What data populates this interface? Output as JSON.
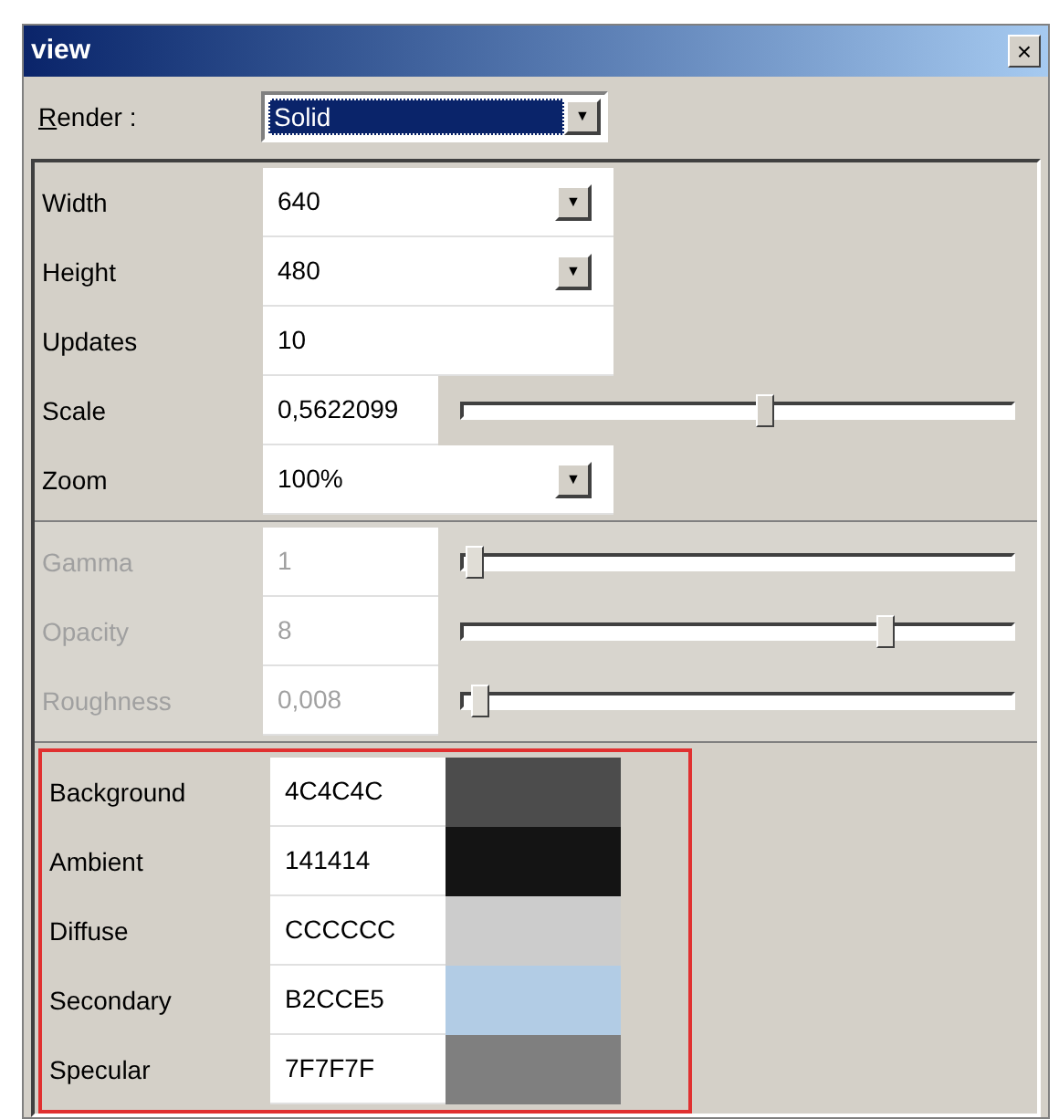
{
  "window": {
    "title": "view",
    "close": "×"
  },
  "render": {
    "label": "Render :",
    "value": "Solid",
    "arrow": "▼"
  },
  "groups": [
    {
      "disabled": false,
      "rows": [
        {
          "kind": "dropdown",
          "label": "Width",
          "value": "640",
          "arrow": "▼"
        },
        {
          "kind": "dropdown",
          "label": "Height",
          "value": "480",
          "arrow": "▼"
        },
        {
          "kind": "text",
          "label": "Updates",
          "value": "10"
        },
        {
          "kind": "slider",
          "label": "Scale",
          "value": "0,5622099",
          "level": 0.55
        },
        {
          "kind": "dropdown",
          "label": "Zoom",
          "value": "100%",
          "arrow": "▼"
        }
      ]
    },
    {
      "disabled": true,
      "rows": [
        {
          "kind": "slider",
          "label": "Gamma",
          "value": "1",
          "level": 0.02
        },
        {
          "kind": "slider",
          "label": "Opacity",
          "value": "8",
          "level": 0.77
        },
        {
          "kind": "slider",
          "label": "Roughness",
          "value": "0,008",
          "level": 0.03
        }
      ]
    }
  ],
  "colors": [
    {
      "label": "Background",
      "value": "4C4C4C",
      "color": "#4c4c4c"
    },
    {
      "label": "Ambient",
      "value": "141414",
      "color": "#141414"
    },
    {
      "label": "Diffuse",
      "value": "CCCCCC",
      "color": "#cccccc"
    },
    {
      "label": "Secondary",
      "value": "B2CCE5",
      "color": "#b2cce5"
    },
    {
      "label": "Specular",
      "value": "7F7F7F",
      "color": "#7f7f7f"
    }
  ]
}
